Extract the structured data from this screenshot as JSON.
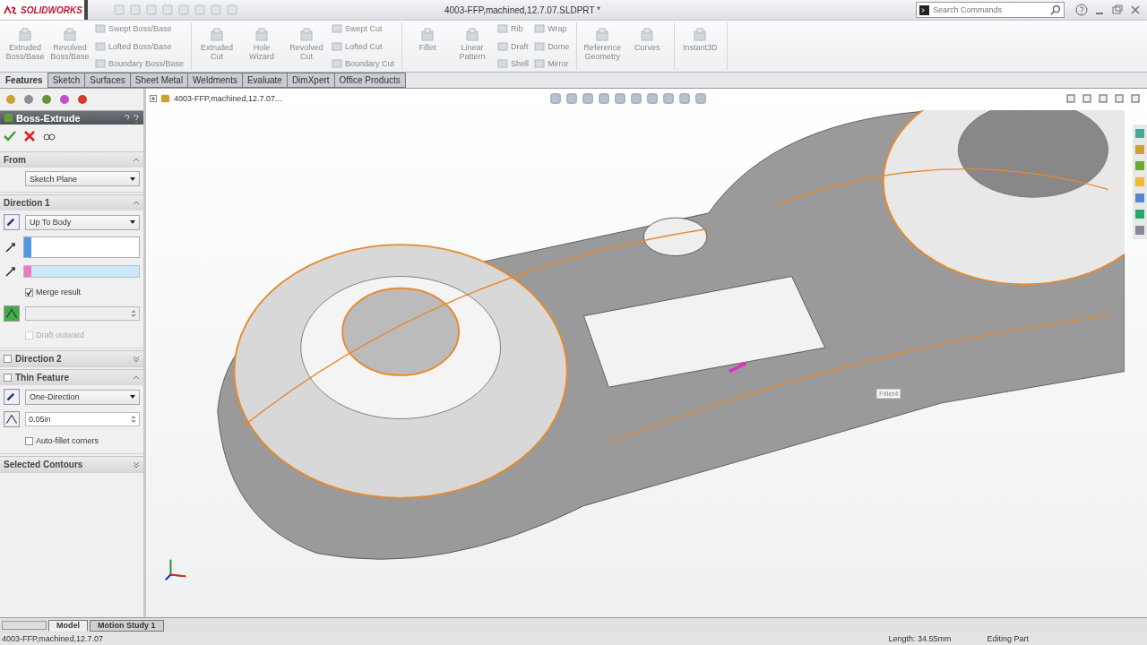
{
  "app": {
    "logo": "SOLIDWORKS",
    "title": "4003-FFP,machined,12.7.07.SLDPRT *",
    "search": {
      "placeholder": "Search Commands"
    }
  },
  "ribbon": [
    {
      "items": [
        {
          "kind": "large",
          "label": "Extruded Boss/Base"
        },
        {
          "kind": "large",
          "label": "Revolved Boss/Base"
        },
        {
          "kind": "stack",
          "items": [
            "Swept Boss/Base",
            "Lofted Boss/Base",
            "Boundary Boss/Base"
          ]
        }
      ]
    },
    {
      "items": [
        {
          "kind": "large",
          "label": "Extruded Cut"
        },
        {
          "kind": "large",
          "label": "Hole Wizard"
        },
        {
          "kind": "large",
          "label": "Revolved Cut"
        },
        {
          "kind": "stack",
          "items": [
            "Swept Cut",
            "Lofted Cut",
            "Boundary Cut"
          ]
        }
      ]
    },
    {
      "items": [
        {
          "kind": "large",
          "label": "Fillet"
        },
        {
          "kind": "large",
          "label": "Linear Pattern"
        },
        {
          "kind": "stack",
          "items": [
            "Rib",
            "Draft",
            "Shell"
          ]
        },
        {
          "kind": "stack",
          "items": [
            "Wrap",
            "Dome",
            "Mirror"
          ]
        }
      ]
    },
    {
      "items": [
        {
          "kind": "large",
          "label": "Reference Geometry"
        },
        {
          "kind": "large",
          "label": "Curves"
        }
      ]
    },
    {
      "items": [
        {
          "kind": "large",
          "label": "Instant3D"
        }
      ]
    }
  ],
  "tabs": [
    {
      "label": "Features",
      "selected": true
    },
    {
      "label": "Sketch",
      "selected": false
    },
    {
      "label": "Surfaces",
      "selected": false
    },
    {
      "label": "Sheet Metal",
      "selected": false
    },
    {
      "label": "Weldments",
      "selected": false
    },
    {
      "label": "Evaluate",
      "selected": false
    },
    {
      "label": "DimXpert",
      "selected": false
    },
    {
      "label": "Office Products",
      "selected": false
    }
  ],
  "property_manager": {
    "title": "Boss-Extrude",
    "sections": [
      {
        "title": "From",
        "expanded": true,
        "rows": [
          {
            "kind": "select",
            "value": "Sketch Plane"
          }
        ]
      },
      {
        "title": "Direction 1",
        "expanded": true,
        "rows": [
          {
            "kind": "icon_select",
            "value": "Up To Body"
          },
          {
            "kind": "field",
            "color": "#4f9ae6",
            "selected": false
          },
          {
            "kind": "field",
            "color": "#e77ac0",
            "selected": true
          },
          {
            "kind": "checkbox",
            "label": "Merge result",
            "checked": true,
            "disabled": false
          },
          {
            "kind": "spin",
            "value": "",
            "disabled": true
          },
          {
            "kind": "checkbox",
            "label": "Draft outward",
            "checked": false,
            "disabled": true
          }
        ]
      },
      {
        "title": "Direction 2",
        "checked": false,
        "expanded": false
      },
      {
        "title": "Thin Feature",
        "checked": false,
        "expanded": true,
        "rows": [
          {
            "kind": "icon_select",
            "value": "One-Direction"
          },
          {
            "kind": "spin",
            "value": "0.05in",
            "disabled": false
          },
          {
            "kind": "checkbox",
            "label": "Auto-fillet corners",
            "checked": false,
            "disabled": false
          }
        ]
      },
      {
        "title": "Selected Contours",
        "expanded": false
      }
    ]
  },
  "tree": {
    "root": "4003-FFP,machined,12.7.07..."
  },
  "viewport": {
    "callout": "Fillet4"
  },
  "bottom_tabs": [
    {
      "label": "Model",
      "selected": true
    },
    {
      "label": "Motion Study 1",
      "selected": false
    }
  ],
  "status_bar": {
    "file": "4003-FFP,machined,12.7.07",
    "length": "Length: 34.55mm",
    "mode": "Editing Part"
  }
}
